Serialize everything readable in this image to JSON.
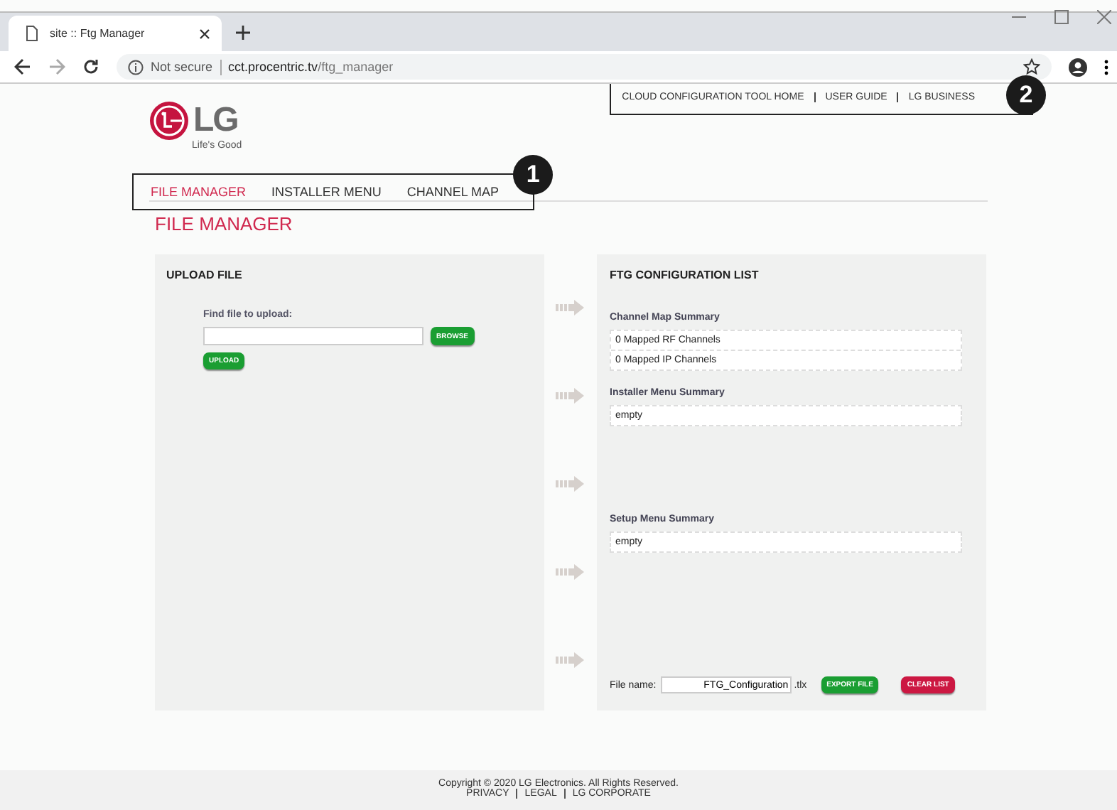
{
  "browser": {
    "tab_title": "site :: Ftg Manager",
    "security": "Not secure",
    "url_host": "cct.procentric.tv",
    "url_path": "/ftg_manager"
  },
  "header": {
    "logo_text": "LG",
    "tagline": "Life's Good",
    "top_links": [
      "CLOUD CONFIGURATION TOOL HOME",
      "USER GUIDE",
      "LG BUSINESS"
    ]
  },
  "nav": [
    {
      "label": "FILE MANAGER",
      "selected": true
    },
    {
      "label": "INSTALLER MENU",
      "selected": false
    },
    {
      "label": "CHANNEL MAP",
      "selected": false
    }
  ],
  "callouts": [
    "1",
    "2"
  ],
  "page_title": "FILE MANAGER",
  "upload": {
    "title": "UPLOAD FILE",
    "label": "Find file to upload:",
    "browse": "BROWSE",
    "upload": "UPLOAD"
  },
  "config": {
    "title": "FTG CONFIGURATION LIST",
    "sections": [
      {
        "heading": "Channel Map Summary",
        "rows": [
          "0 Mapped RF Channels",
          "0 Mapped IP Channels"
        ]
      },
      {
        "heading": "Installer Menu Summary",
        "rows": [
          "empty"
        ]
      },
      {
        "heading": "Setup Menu Summary",
        "rows": [
          "empty"
        ]
      }
    ],
    "file_label": "File name:",
    "file_value": "FTG_Configuration",
    "extension": ".tlx",
    "export": "EXPORT FILE",
    "clear": "CLEAR LIST"
  },
  "footer": {
    "copyright": "Copyright © 2020 LG Electronics. All Rights Reserved.",
    "links": [
      "PRIVACY",
      "LEGAL",
      "LG CORPORATE"
    ]
  }
}
